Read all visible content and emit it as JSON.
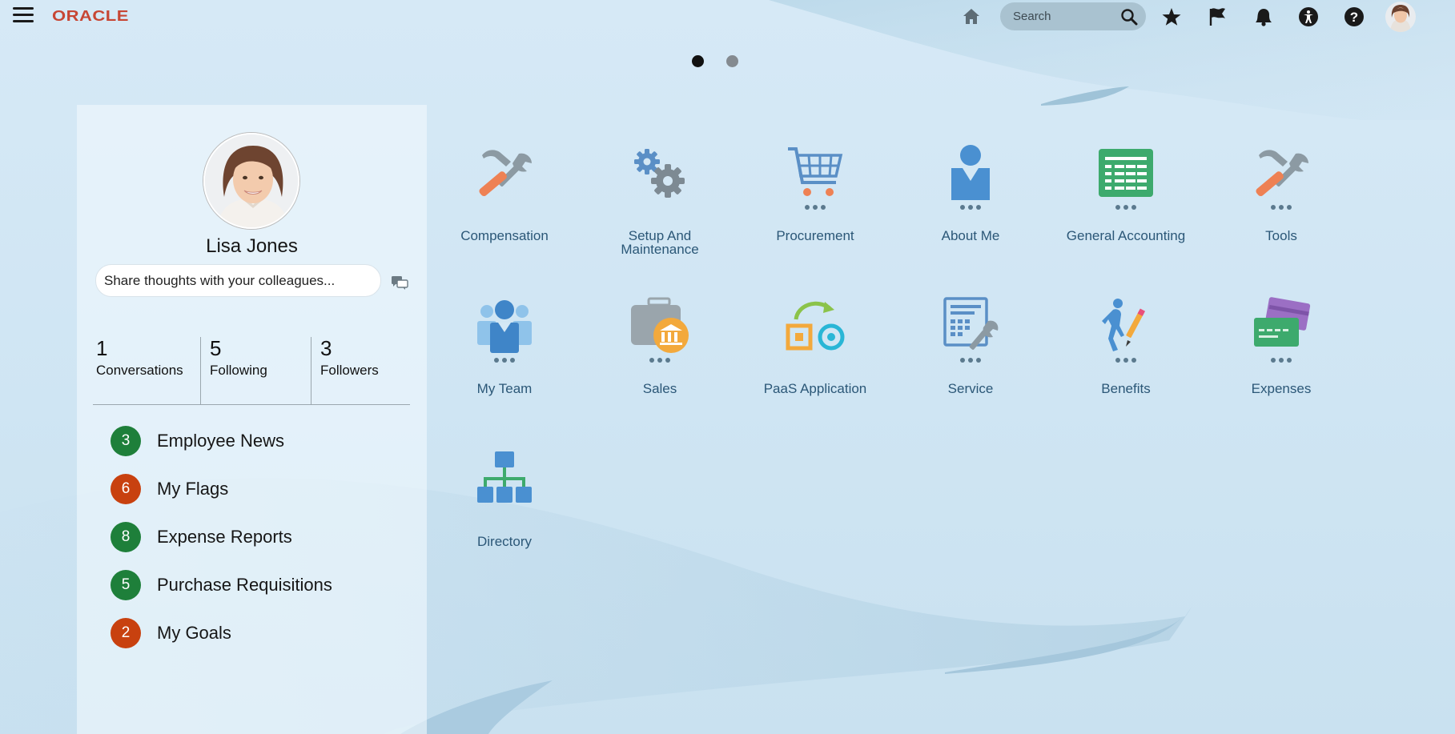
{
  "header": {
    "logo_text": "ORACLE",
    "search_placeholder": "Search",
    "icons": [
      "menu-icon",
      "home-icon",
      "search-icon",
      "star-icon",
      "flag-icon",
      "bell-icon",
      "accessibility-icon",
      "help-icon",
      "user-avatar"
    ]
  },
  "pager": {
    "pages": 2,
    "active": 1
  },
  "profile": {
    "name": "Lisa Jones",
    "share_placeholder": "Share thoughts with your colleagues...",
    "stats": [
      {
        "value": "1",
        "label": "Conversations"
      },
      {
        "value": "5",
        "label": "Following"
      },
      {
        "value": "3",
        "label": "Followers"
      }
    ],
    "worklist": [
      {
        "count": "3",
        "label": "Employee News",
        "color": "#1e7f3a"
      },
      {
        "count": "6",
        "label": "My Flags",
        "color": "#c8410f"
      },
      {
        "count": "8",
        "label": "Expense Reports",
        "color": "#1e7f3a"
      },
      {
        "count": "5",
        "label": "Purchase Requisitions",
        "color": "#1e7f3a"
      },
      {
        "count": "2",
        "label": "My Goals",
        "color": "#c8410f"
      }
    ]
  },
  "apps": [
    {
      "label": "Compensation",
      "icon": "tools-icon"
    },
    {
      "label": "Setup And Maintenance",
      "icon": "gears-icon"
    },
    {
      "label": "Procurement",
      "icon": "cart-icon"
    },
    {
      "label": "About Me",
      "icon": "person-icon"
    },
    {
      "label": "General Accounting",
      "icon": "ledger-icon"
    },
    {
      "label": "Tools",
      "icon": "tools-icon"
    },
    {
      "label": "My Team",
      "icon": "team-icon"
    },
    {
      "label": "Sales",
      "icon": "briefcase-bank-icon"
    },
    {
      "label": "PaaS Application",
      "icon": "paas-icon"
    },
    {
      "label": "Service",
      "icon": "service-icon"
    },
    {
      "label": "Benefits",
      "icon": "benefits-icon"
    },
    {
      "label": "Expenses",
      "icon": "cards-icon"
    },
    {
      "label": "Directory",
      "icon": "org-chart-icon"
    }
  ],
  "colors": {
    "accent": "#c74634",
    "app_label": "#2b5777",
    "green_badge": "#1e7f3a",
    "orange_badge": "#c8410f"
  }
}
